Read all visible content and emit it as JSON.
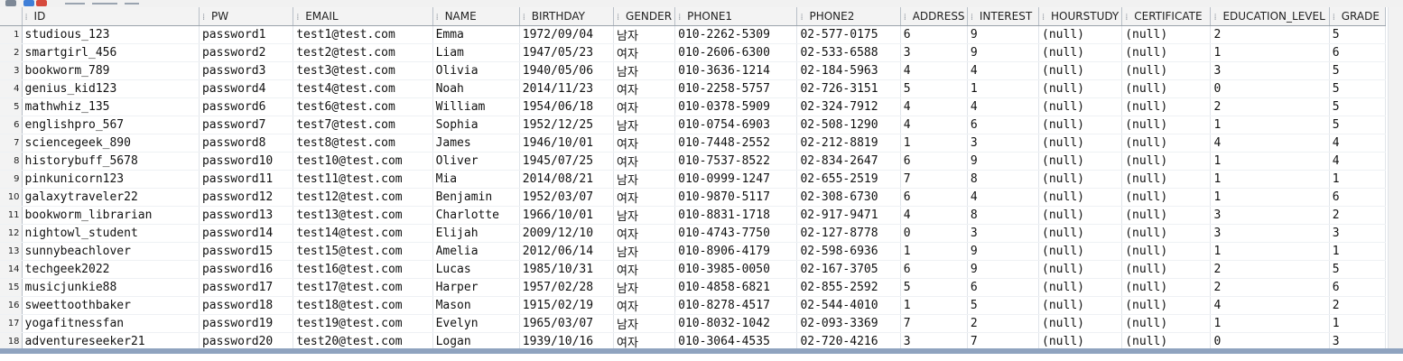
{
  "columns": [
    "ID",
    "PW",
    "EMAIL",
    "NAME",
    "BIRTHDAY",
    "GENDER",
    "PHONE1",
    "PHONE2",
    "ADDRESS",
    "INTEREST",
    "HOURSTUDY",
    "CERTIFICATE",
    "EDUCATION_LEVEL",
    "GRADE"
  ],
  "rows": [
    {
      "n": "1",
      "c": [
        "studious_123",
        "password1",
        "test1@test.com",
        "Emma",
        "1972/09/04",
        "남자",
        "010-2262-5309",
        "02-577-0175",
        "6",
        "9",
        "(null)",
        "(null)",
        "2",
        "5"
      ]
    },
    {
      "n": "2",
      "c": [
        "smartgirl_456",
        "password2",
        "test2@test.com",
        "Liam",
        "1947/05/23",
        "여자",
        "010-2606-6300",
        "02-533-6588",
        "3",
        "9",
        "(null)",
        "(null)",
        "1",
        "6"
      ]
    },
    {
      "n": "3",
      "c": [
        "bookworm_789",
        "password3",
        "test3@test.com",
        "Olivia",
        "1940/05/06",
        "남자",
        "010-3636-1214",
        "02-184-5963",
        "4",
        "4",
        "(null)",
        "(null)",
        "3",
        "5"
      ]
    },
    {
      "n": "4",
      "c": [
        "genius_kid123",
        "password4",
        "test4@test.com",
        "Noah",
        "2014/11/23",
        "여자",
        "010-2258-5757",
        "02-726-3151",
        "5",
        "1",
        "(null)",
        "(null)",
        "0",
        "5"
      ]
    },
    {
      "n": "5",
      "c": [
        "mathwhiz_135",
        "password6",
        "test6@test.com",
        "William",
        "1954/06/18",
        "여자",
        "010-0378-5909",
        "02-324-7912",
        "4",
        "4",
        "(null)",
        "(null)",
        "2",
        "5"
      ]
    },
    {
      "n": "6",
      "c": [
        "englishpro_567",
        "password7",
        "test7@test.com",
        "Sophia",
        "1952/12/25",
        "남자",
        "010-0754-6903",
        "02-508-1290",
        "4",
        "6",
        "(null)",
        "(null)",
        "1",
        "5"
      ]
    },
    {
      "n": "7",
      "c": [
        "sciencegeek_890",
        "password8",
        "test8@test.com",
        "James",
        "1946/10/01",
        "여자",
        "010-7448-2552",
        "02-212-8819",
        "1",
        "3",
        "(null)",
        "(null)",
        "4",
        "4"
      ]
    },
    {
      "n": "8",
      "c": [
        "historybuff_5678",
        "password10",
        "test10@test.com",
        "Oliver",
        "1945/07/25",
        "여자",
        "010-7537-8522",
        "02-834-2647",
        "6",
        "9",
        "(null)",
        "(null)",
        "1",
        "4"
      ]
    },
    {
      "n": "9",
      "c": [
        "pinkunicorn123",
        "password11",
        "test11@test.com",
        "Mia",
        "2014/08/21",
        "남자",
        "010-0999-1247",
        "02-655-2519",
        "7",
        "8",
        "(null)",
        "(null)",
        "1",
        "1"
      ]
    },
    {
      "n": "10",
      "c": [
        "galaxytraveler22",
        "password12",
        "test12@test.com",
        "Benjamin",
        "1952/03/07",
        "여자",
        "010-9870-5117",
        "02-308-6730",
        "6",
        "4",
        "(null)",
        "(null)",
        "1",
        "6"
      ]
    },
    {
      "n": "11",
      "c": [
        "bookworm_librarian",
        "password13",
        "test13@test.com",
        "Charlotte",
        "1966/10/01",
        "남자",
        "010-8831-1718",
        "02-917-9471",
        "4",
        "8",
        "(null)",
        "(null)",
        "3",
        "2"
      ]
    },
    {
      "n": "12",
      "c": [
        "nightowl_student",
        "password14",
        "test14@test.com",
        "Elijah",
        "2009/12/10",
        "여자",
        "010-4743-7750",
        "02-127-8778",
        "0",
        "3",
        "(null)",
        "(null)",
        "3",
        "3"
      ]
    },
    {
      "n": "13",
      "c": [
        "sunnybeachlover",
        "password15",
        "test15@test.com",
        "Amelia",
        "2012/06/14",
        "남자",
        "010-8906-4179",
        "02-598-6936",
        "1",
        "9",
        "(null)",
        "(null)",
        "1",
        "1"
      ]
    },
    {
      "n": "14",
      "c": [
        "techgeek2022",
        "password16",
        "test16@test.com",
        "Lucas",
        "1985/10/31",
        "여자",
        "010-3985-0050",
        "02-167-3705",
        "6",
        "9",
        "(null)",
        "(null)",
        "2",
        "5"
      ]
    },
    {
      "n": "15",
      "c": [
        "musicjunkie88",
        "password17",
        "test17@test.com",
        "Harper",
        "1957/02/28",
        "남자",
        "010-4858-6821",
        "02-855-2592",
        "5",
        "6",
        "(null)",
        "(null)",
        "2",
        "6"
      ]
    },
    {
      "n": "16",
      "c": [
        "sweettoothbaker",
        "password18",
        "test18@test.com",
        "Mason",
        "1915/02/19",
        "여자",
        "010-8278-4517",
        "02-544-4010",
        "1",
        "5",
        "(null)",
        "(null)",
        "4",
        "2"
      ]
    },
    {
      "n": "17",
      "c": [
        "yogafitnessfan",
        "password19",
        "test19@test.com",
        "Evelyn",
        "1965/03/07",
        "남자",
        "010-8032-1042",
        "02-093-3369",
        "7",
        "2",
        "(null)",
        "(null)",
        "1",
        "1"
      ]
    },
    {
      "n": "18",
      "c": [
        "adventureseeker21",
        "password20",
        "test20@test.com",
        "Logan",
        "1939/10/16",
        "여자",
        "010-3064-4535",
        "02-720-4216",
        "3",
        "7",
        "(null)",
        "(null)",
        "0",
        "3"
      ]
    }
  ],
  "icons": {
    "toolbar": [
      "grid-icon",
      "database-icon",
      "close-icon"
    ]
  }
}
